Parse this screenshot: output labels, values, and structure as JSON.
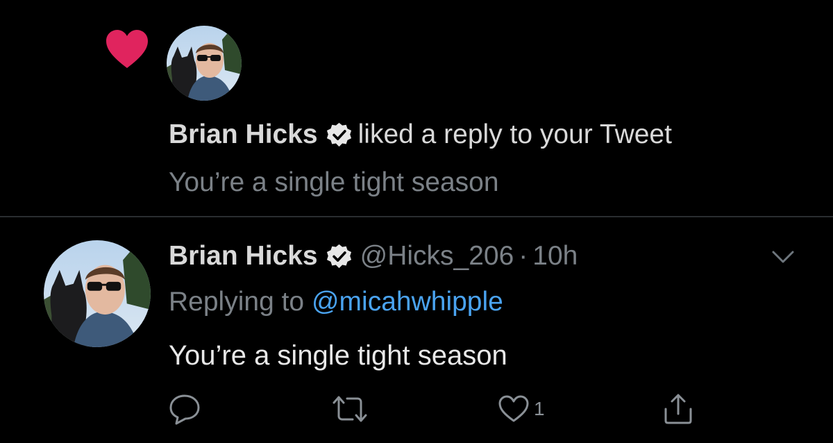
{
  "notification": {
    "user_name": "Brian Hicks",
    "action_text": "liked a reply to your Tweet",
    "preview_text": "You’re a single tight season",
    "icon": "heart-icon",
    "heart_color": "#e0245e"
  },
  "tweet": {
    "user_name": "Brian Hicks",
    "handle": "@Hicks_206",
    "separator": "·",
    "time": "10h",
    "replying_prefix": "Replying to",
    "replying_to": "@micahwhipple",
    "text": "You’re a single tight season",
    "actions": {
      "reply_icon": "reply-icon",
      "retweet_icon": "retweet-icon",
      "like_icon": "like-icon",
      "like_count": "1",
      "share_icon": "share-icon"
    }
  },
  "colors": {
    "background": "#000000",
    "secondary_text": "#7b8187",
    "link": "#4aa3f0",
    "divider": "#2a2d30"
  }
}
